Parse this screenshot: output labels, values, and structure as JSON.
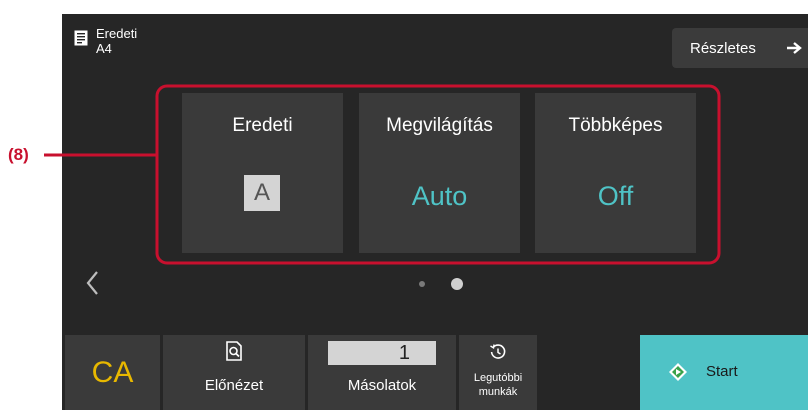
{
  "header": {
    "original_label": "Eredeti",
    "original_size": "A4",
    "details_button": "Részletes"
  },
  "tiles": [
    {
      "title": "Eredeti",
      "value": "A"
    },
    {
      "title": "Megvilágítás",
      "value": "Auto"
    },
    {
      "title": "Többképes",
      "value": "Off"
    }
  ],
  "pager": {
    "pages": 2,
    "active_page": 2
  },
  "bottom_bar": {
    "ca_label": "CA",
    "preview_label": "Előnézet",
    "copies_value": "1",
    "copies_label": "Másolatok",
    "recent_jobs_label_line1": "Legutóbbi",
    "recent_jobs_label_line2": "munkák",
    "start_label": "Start"
  },
  "callout": {
    "label": "(8)",
    "color": "#c8102e"
  },
  "colors": {
    "accent": "#4fc3c6",
    "ca": "#e8b800",
    "background": "#262626",
    "tile": "#3a3a3a"
  }
}
